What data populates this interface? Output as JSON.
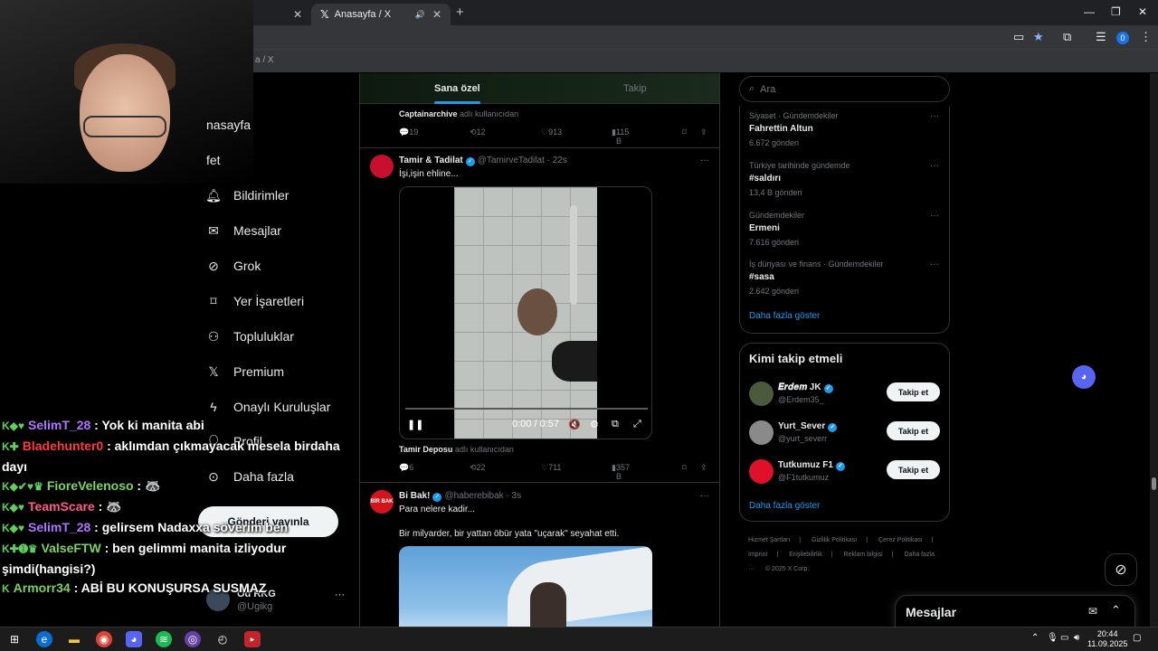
{
  "browser": {
    "tab_other_close": "✕",
    "tab_active_title": "Anasayfa / X",
    "tab_active_mute": "🔊",
    "tab_active_close": "✕",
    "new_tab": "+",
    "breadcrumb": "a / X",
    "profile_count": "0",
    "win_min": "—",
    "win_restore": "❐",
    "win_close": "✕"
  },
  "nav": {
    "items": [
      {
        "label": "nasayfa",
        "icon": "home-icon"
      },
      {
        "label": "fet",
        "icon": "explore-icon"
      },
      {
        "label": "Bildirimler",
        "icon": "bell-icon"
      },
      {
        "label": "Mesajlar",
        "icon": "mail-icon"
      },
      {
        "label": "Grok",
        "icon": "grok-icon"
      },
      {
        "label": "Yer İşaretleri",
        "icon": "bookmark-icon"
      },
      {
        "label": "Topluluklar",
        "icon": "communities-icon"
      },
      {
        "label": "Premium",
        "icon": "x-icon"
      },
      {
        "label": "Onaylı Kuruluşlar",
        "icon": "lightning-icon"
      },
      {
        "label": "Profil",
        "icon": "person-icon"
      },
      {
        "label": "Daha fazla",
        "icon": "more-circle-icon"
      }
    ],
    "post_button": "Gönderi yayınla",
    "account_name": "Od RKG",
    "account_handle": "@Ugikg",
    "account_more": "···"
  },
  "chat": [
    {
      "user": "SelimT_28",
      "color": "#b173ff",
      "text": " : Yok ki manita abi"
    },
    {
      "user": "Bladehunter0",
      "color": "#ff3a3a",
      "text": " : aklımdan çıkmayacak mesela birdaha dayı"
    },
    {
      "user": "FioreVelenoso",
      "color": "#7dd35e",
      "text": " : 🦝"
    },
    {
      "user": "TeamScare",
      "color": "#ff5a8a",
      "text": " : 🦝"
    },
    {
      "user": "SelimT_28",
      "color": "#b173ff",
      "text": " : gelirsem Nadaxxa söverim ben"
    },
    {
      "user": "ValseFTW",
      "color": "#7dd35e",
      "text": " : ben gelimmi manita izliyodur şimdi(hangisi?)"
    },
    {
      "user": "Armorr34",
      "color": "#7dd35e",
      "text": " : ABİ BU KONUŞURSA SUSMAZ"
    }
  ],
  "timeline": {
    "tab_foryou": "Sana özel",
    "tab_following": "Takip",
    "top_repost_user": "Captainarchive",
    "top_repost_suffix": " adlı kullanıcıdan",
    "top_actions": {
      "replies": "19",
      "reposts": "12",
      "likes": "913",
      "views": "115 B"
    },
    "post1": {
      "name": "Tamir & Tadilat",
      "handle": "@TamirveTadilat · 22s",
      "text": "İşi,işin ehline...",
      "video_time": "0:00 / 0:57",
      "video_progress": 0.0,
      "repost_user": "Tamir Deposu",
      "repost_suffix": " adlı kullanıcıdan",
      "actions": {
        "replies": "6",
        "reposts": "22",
        "likes": "711",
        "views": "357 B"
      },
      "more": "···"
    },
    "post2": {
      "name": "Bi Bak!",
      "handle": "@haberebibak · 3s",
      "text1": "Para nelere kadir...",
      "text2": "Bir milyarder, bir yattan öbür yata \"uçarak\" seyahat etti.",
      "avatar_text": "BİR BAK",
      "more": "···"
    }
  },
  "search": {
    "placeholder": "Ara"
  },
  "trends": [
    {
      "context": "Siyaset · Gündemdekiler",
      "title": "Fahrettin Altun",
      "count": "6.672 gönderi"
    },
    {
      "context": "Türkiye tarihinde gündemde",
      "title": "#saldırı",
      "count": "13,4 B gönderi"
    },
    {
      "context": "Gündemdekiler",
      "title": "Ermeni",
      "count": "7.616 gönderi"
    },
    {
      "context": "İş dünyası ve finans · Gündemdekiler",
      "title": "#sasa",
      "count": "2.642 gönderi"
    }
  ],
  "trends_show_more": "Daha fazla göster",
  "who_to_follow": {
    "title": "Kimi takip etmeli",
    "items": [
      {
        "name": "𝑬𝒓𝒅𝒆𝒎 JK",
        "handle": "@Erdem35_",
        "button": "Takip et"
      },
      {
        "name": "Yurt_Sever",
        "handle": "@yurt_severr",
        "button": "Takip et"
      },
      {
        "name": "Tutkumuz F1",
        "handle": "@F1tutkumuz",
        "button": "Takip et"
      }
    ],
    "show_more": "Daha fazla göster"
  },
  "footer": [
    "Hizmet Şartları",
    "|",
    "Gizlilik Politikası",
    "|",
    "Çerez Politikası",
    "|",
    "Imprint",
    "|",
    "Erişilebilirlik",
    "|",
    "Reklam bilgisi",
    "|",
    "Daha fazla ···",
    "© 2025 X Corp."
  ],
  "messages_drawer": {
    "title": "Mesajlar"
  },
  "taskbar": {
    "time": "20:44",
    "date": "11.09.2025"
  },
  "colors": {
    "accent": "#1d9bf0",
    "background": "#000000",
    "border": "#2f3336"
  }
}
